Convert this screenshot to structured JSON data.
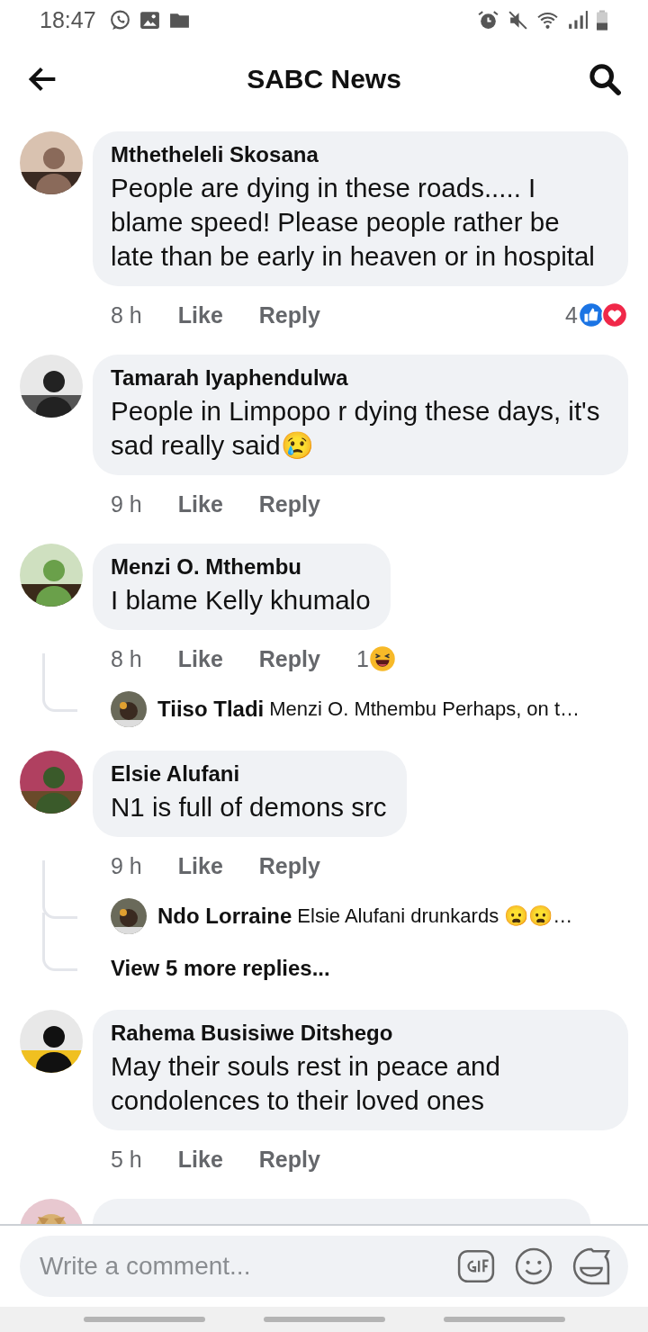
{
  "status_bar": {
    "time": "18:47"
  },
  "header": {
    "title": "SABC News"
  },
  "comments": [
    {
      "name": "Mthetheleli Skosana",
      "text": "People are dying in these roads..... I blame speed! Please people rather be late than be early in heaven or in hospital",
      "time": "8 h",
      "like": "Like",
      "reply": "Reply",
      "reactions": {
        "count": "4",
        "icons": [
          {
            "kind": "like"
          },
          {
            "kind": "love"
          }
        ]
      }
    },
    {
      "name": "Tamarah Iyaphendulwa",
      "text": "People in Limpopo r dying these days, it's sad really said😢",
      "time": "9 h",
      "like": "Like",
      "reply": "Reply"
    },
    {
      "name": "Menzi O. Mthembu",
      "text": "I blame Kelly khumalo",
      "time": "8 h",
      "like": "Like",
      "reply": "Reply",
      "reactions": {
        "count": "1",
        "icons": [
          {
            "kind": "haha"
          }
        ]
      },
      "replies": [
        {
          "name": "Tiiso Tladi",
          "text": "Menzi O. Mthembu Perhaps, on t…"
        }
      ]
    },
    {
      "name": "Elsie Alufani",
      "text": "N1 is full of demons src",
      "time": "9 h",
      "like": "Like",
      "reply": "Reply",
      "replies": [
        {
          "name": "Ndo Lorraine",
          "text": "Elsie Alufani drunkards 😦😦…"
        }
      ],
      "more_replies": "View 5 more replies..."
    },
    {
      "name": "Rahema Busisiwe Ditshego",
      "text": "May their souls rest in peace and condolences to their loved ones",
      "time": "5 h",
      "like": "Like",
      "reply": "Reply"
    }
  ],
  "composer": {
    "placeholder": "Write a comment..."
  }
}
